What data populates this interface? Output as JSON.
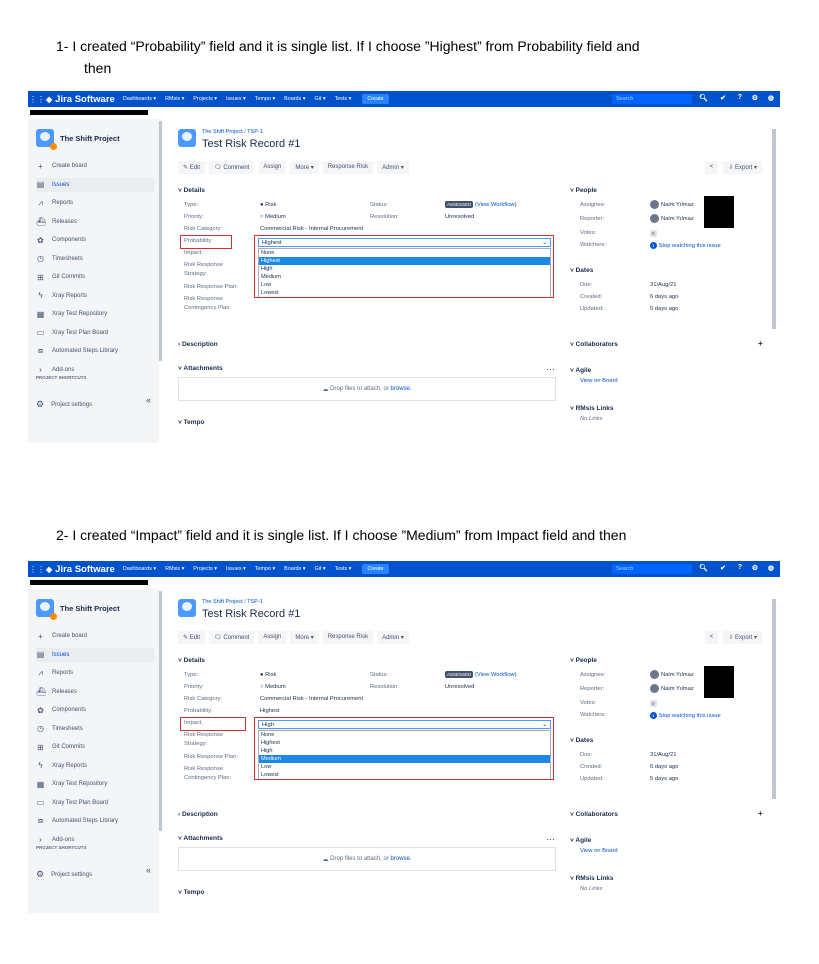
{
  "steps": [
    {
      "text_line1": "1-   I created “Probability” field and it is single list. If I choose ”Highest” from Probability field and",
      "text_line2": "then"
    },
    {
      "text_line1": "2-   I created “Impact” field and it is single list. If I choose ”Medium” from Impact field and then"
    }
  ],
  "topnav": {
    "product": "Jira Software",
    "items": [
      "Dashboards ▾",
      "RMsis ▾",
      "Projects ▾",
      "Issues ▾",
      "Tempo ▾",
      "Boards ▾",
      "Git ▾",
      "Tests ▾"
    ],
    "create": "Create",
    "search_placeholder": "Search"
  },
  "sidebar": {
    "project_name": "The Shift Project",
    "items": [
      {
        "label": "Create board",
        "icon": "plus-icon"
      },
      {
        "label": "Issues",
        "icon": "issues-icon"
      },
      {
        "label": "Reports",
        "icon": "reports-icon"
      },
      {
        "label": "Releases",
        "icon": "releases-icon"
      },
      {
        "label": "Components",
        "icon": "components-icon"
      },
      {
        "label": "Timesheets",
        "icon": "timesheets-icon"
      },
      {
        "label": "Git Commits",
        "icon": "git-icon"
      },
      {
        "label": "Xray Reports",
        "icon": "xray-icon"
      },
      {
        "label": "Xray Test Repository",
        "icon": "repository-icon"
      },
      {
        "label": "Xray Test Plan Board",
        "icon": "board-icon"
      },
      {
        "label": "Automated Steps Library",
        "icon": "library-icon"
      },
      {
        "label": "Add-ons",
        "icon": "chevron-right-icon"
      }
    ],
    "shortcuts": "PROJECT SHORTCUTS",
    "settings": "Project settings",
    "collapse": "«"
  },
  "issue": {
    "breadcrumb_project": "The Shift Project",
    "breadcrumb_sep": "/",
    "breadcrumb_key": "TSP-1",
    "title": "Test Risk Record #1",
    "toolbar": [
      "✎ Edit",
      "🗨 Comment",
      "Assign",
      "More ▾",
      "Response Risk",
      "Admin ▾"
    ],
    "share": "<",
    "export": "⇩ Export ▾",
    "details_header": "Details",
    "type_label": "Type:",
    "type_value": "● Risk",
    "priority_label": "Priority:",
    "priority_value": "○ Medium",
    "category_label": "Risk Category:",
    "category_value": "Commercial Risk - Internal Procurement",
    "status_label": "Status:",
    "status_badge": "ASSESSED",
    "status_link": "(View Workflow)",
    "resolution_label": "Resolution:",
    "resolution_value": "Unresolved",
    "probability_label": "Probability:",
    "impact_label": "Impact:",
    "risk_response_strategy_1": "Risk Response",
    "risk_response_strategy_2": "Strategy:",
    "risk_response_plan": "Risk Response Plan:",
    "contingency_1": "Risk Response",
    "contingency_2": "Contingency Plan:",
    "description_header": "Description",
    "attachments_header": "Attachments",
    "drop_text": "Drop files to attach, or",
    "browse": "browse.",
    "tempo_header": "Tempo",
    "more_dots": "…"
  },
  "shot1": {
    "probability_selected": "Highest",
    "options": [
      "None",
      "Highest",
      "High",
      "Medium",
      "Low",
      "Lowest"
    ],
    "highlighted": "Highest"
  },
  "shot2": {
    "probability_value": "Highest",
    "impact_selected": "High",
    "options": [
      "None",
      "Highest",
      "High",
      "Medium",
      "Low",
      "Lowest"
    ],
    "highlighted": "Medium"
  },
  "people": {
    "header": "People",
    "assignee_label": "Assignee:",
    "assignee": "Naim Yılmaz",
    "reporter_label": "Reporter:",
    "reporter": "Naim Yılmaz",
    "votes_label": "Votes:",
    "votes": "0",
    "watchers_label": "Watchers:",
    "watchers_count": "1",
    "watch_link": "Stop watching this issue"
  },
  "dates": {
    "header": "Dates",
    "due_label": "Due:",
    "due": "31/Aug/21",
    "created_label": "Created:",
    "created": "6 days ago",
    "updated_label": "Updated:",
    "updated": "5 days ago"
  },
  "collaborators_header": "Collaborators",
  "collab_add": "+",
  "agile": {
    "header": "Agile",
    "link": "View on Board"
  },
  "rmsis": {
    "header": "RMsis Links",
    "value": "No Links"
  },
  "colors": {
    "nav": "#0052cc",
    "highlight": "#1e88e5",
    "redbox": "#d32f2f"
  }
}
